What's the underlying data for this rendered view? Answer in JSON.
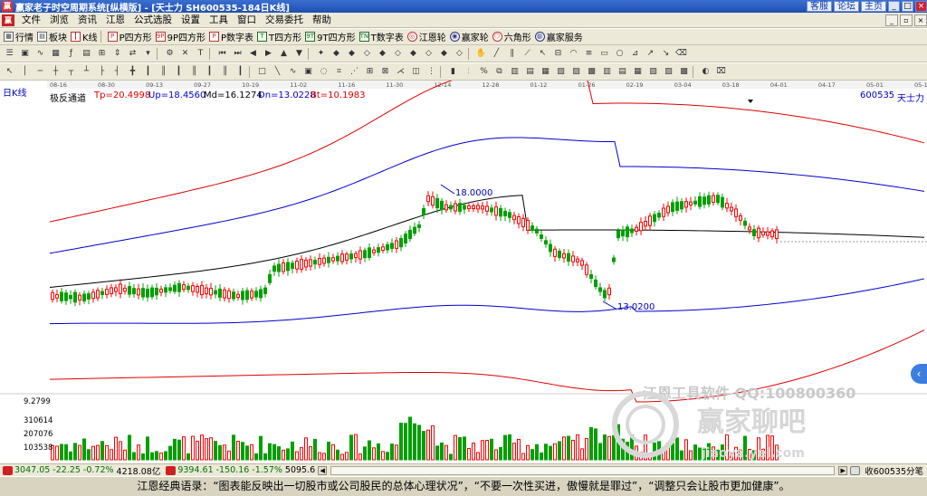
{
  "window": {
    "title": "赢家老子时空周期系统[纵横版] - [天士力   SH600535-184日K线]",
    "quick_links": [
      "客服",
      "论坛",
      "主页"
    ],
    "buttons": [
      "_",
      "□",
      "×"
    ]
  },
  "menu": {
    "items": [
      "文件",
      "浏览",
      "资讯",
      "江恩",
      "公式选股",
      "设置",
      "工具",
      "窗口",
      "交易委托",
      "帮助"
    ]
  },
  "toolbar1": {
    "items": [
      {
        "label": "行情",
        "icon": "quote-icon"
      },
      {
        "label": "板块",
        "icon": "sector-icon"
      },
      {
        "label": "K线",
        "icon": "kline-icon"
      },
      {
        "label": "P四方形",
        "icon": "p-square-icon",
        "tag": "P"
      },
      {
        "label": "9P四方形",
        "icon": "9p-square-icon",
        "tag": "9P"
      },
      {
        "label": "P数字表",
        "icon": "p-number-table-icon",
        "tag": "P"
      },
      {
        "label": "T四方形",
        "icon": "t-square-icon",
        "tag": "T"
      },
      {
        "label": "9T四方形",
        "icon": "9t-square-icon",
        "tag": "9T"
      },
      {
        "label": "T数字表",
        "icon": "t-number-table-icon",
        "tag": "TN"
      },
      {
        "label": "江恩轮",
        "icon": "gann-wheel-icon"
      },
      {
        "label": "赢家轮",
        "icon": "winner-wheel-icon"
      },
      {
        "label": "六角形",
        "icon": "hexagon-icon"
      },
      {
        "label": "赢家服务",
        "icon": "winner-service-icon"
      }
    ]
  },
  "chart": {
    "period_label": "日K线",
    "indicator_name": "极反通道",
    "indicator_values": [
      {
        "key": "Tp",
        "text": "Tp=20.4998",
        "color": "#e00000"
      },
      {
        "key": "Up",
        "text": "Up=18.4560",
        "color": "#0000d0"
      },
      {
        "key": "Md",
        "text": "Md=16.1274",
        "color": "#000000"
      },
      {
        "key": "Dn",
        "text": "Dn=13.0228",
        "color": "#0000d0"
      },
      {
        "key": "Bt",
        "text": "Bt=10.1983",
        "color": "#e00000"
      }
    ],
    "stock_code": "600535",
    "stock_name": "天士力",
    "date_ticks": [
      "08-16",
      "08-30",
      "09-13",
      "09-27",
      "10-19",
      "11-02",
      "11-16",
      "11-30",
      "12-14",
      "12-28",
      "01-12",
      "01-26",
      "02-19",
      "03-04",
      "03-18",
      "04-01",
      "04-17",
      "05-01",
      "05-15"
    ],
    "high_annotation": "18.0000",
    "low_annotation": "13.0200",
    "volume_axis": [
      "310614",
      "207076",
      "103538"
    ],
    "price_axis_top": "9.2799",
    "colors": {
      "up_candle": "#ff0000",
      "down_candle": "#00a000",
      "outer_band": "#e00000",
      "inner_band": "#0000d0",
      "middle": "#000000"
    }
  },
  "watermarks": {
    "line1": "江恩工具软件  QQ:100800360",
    "line2": "赢家聊吧",
    "line3": "jiaoya.yel.com"
  },
  "statusbar": {
    "sh_value": "3047.05",
    "sh_change": "-22.25",
    "sh_pct": "-0.72%",
    "sh_amount": "4218.08亿",
    "sz_value": "9394.61",
    "sz_change": "-150.16",
    "sz_pct": "-1.57%",
    "sz_amount": "5095.6",
    "stock_link": "收600535分笔"
  },
  "quote": "江恩经典语录：“图表能反映出一切股市或公司股民的总体心理状况”，“不要一次性买进，傲慢就是罪过”，“调整只会让股市更加健康”。"
}
